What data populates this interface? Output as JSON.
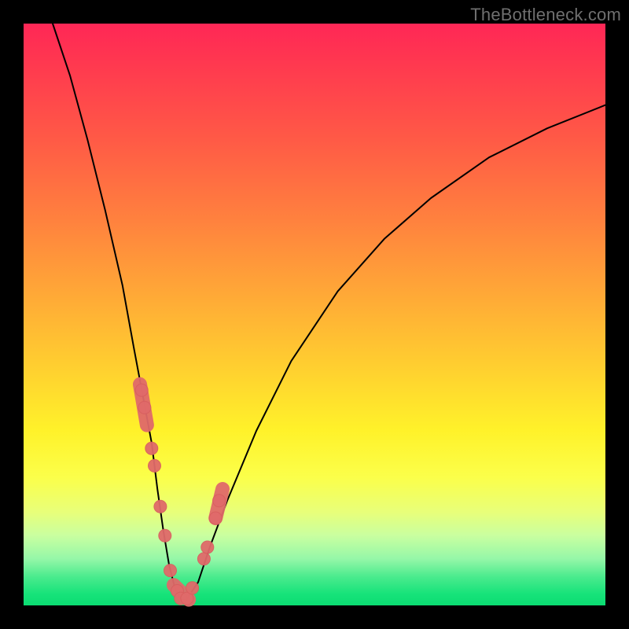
{
  "watermark": "TheBottleneck.com",
  "chart_data": {
    "type": "line",
    "title": "",
    "xlabel": "",
    "ylabel": "",
    "xlim": [
      0,
      100
    ],
    "ylim": [
      0,
      100
    ],
    "series": [
      {
        "name": "bottleneck-curve",
        "x": [
          5,
          8,
          11,
          14,
          17,
          19,
          20.5,
          22,
          23,
          24,
          25,
          26,
          27,
          28,
          30,
          32,
          35,
          40,
          46,
          54,
          62,
          70,
          80,
          90,
          100
        ],
        "y": [
          100,
          91,
          80,
          68,
          55,
          44,
          36,
          28,
          20,
          13,
          7,
          3,
          1,
          1,
          4,
          10,
          18,
          30,
          42,
          54,
          63,
          70,
          77,
          82,
          86
        ]
      }
    ],
    "points": {
      "name": "highlighted-samples",
      "x": [
        20.3,
        20.8,
        22.0,
        22.5,
        23.5,
        24.3,
        25.2,
        26.4,
        27.0,
        28.1,
        29.0,
        31.0,
        31.6,
        33.0,
        33.6
      ],
      "y": [
        37,
        34,
        27,
        24,
        17,
        12,
        6,
        2.5,
        1.2,
        1.2,
        3,
        8,
        10,
        15,
        18
      ]
    },
    "lozenges": {
      "name": "highlighted-ranges",
      "segments": [
        {
          "x": [
            20.0,
            21.2
          ],
          "y": [
            38,
            31
          ]
        },
        {
          "x": [
            25.8,
            28.4
          ],
          "y": [
            3.5,
            1.0
          ]
        },
        {
          "x": [
            33.0,
            34.2
          ],
          "y": [
            15,
            20
          ]
        }
      ]
    }
  },
  "colors": {
    "curve": "#000000",
    "marker_fill": "#e06a6a",
    "marker_stroke": "#d85f5f"
  }
}
